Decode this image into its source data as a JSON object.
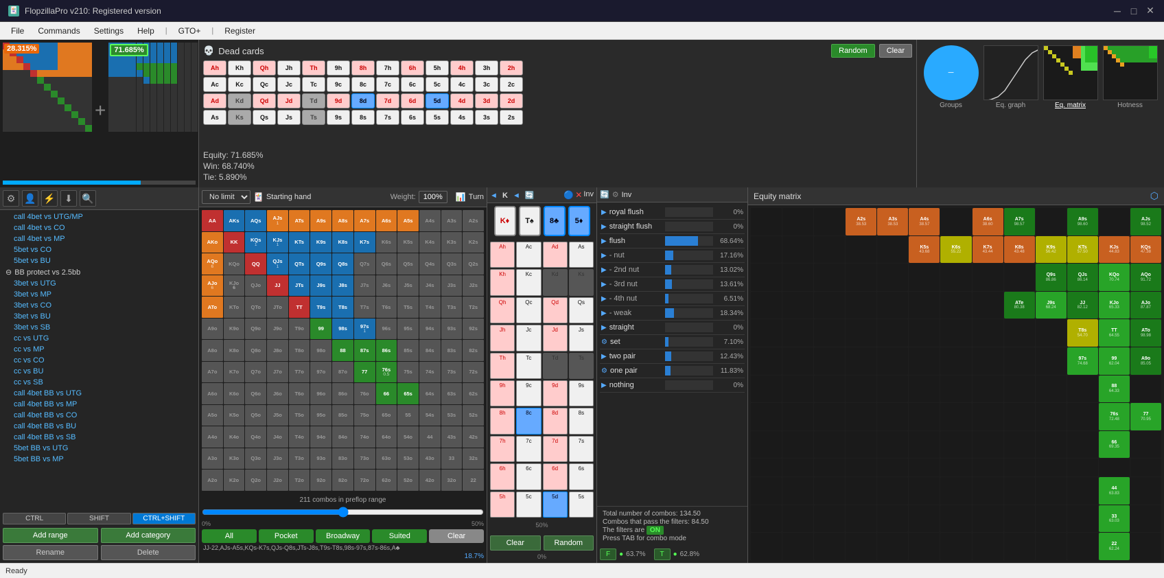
{
  "app": {
    "title": "FlopzillaPro v210: Registered version",
    "icon": "🎴"
  },
  "menu": {
    "items": [
      "File",
      "Commands",
      "Settings",
      "Help",
      "|",
      "GTO+",
      "|",
      "Register"
    ]
  },
  "top_left": {
    "pct1": "28.315%",
    "pct2": "71.685%",
    "pct1_color": "#e8680a",
    "pct2_color": "#2d8a2d"
  },
  "dead_cards": {
    "title": "Dead cards",
    "skull": "💀",
    "rows": [
      [
        "Ah",
        "Kh",
        "Qh",
        "Jh",
        "Th",
        "9h",
        "8h",
        "7h",
        "6h",
        "5h",
        "4h",
        "3h",
        "2h"
      ],
      [
        "Ac",
        "Kc",
        "Qc",
        "Jc",
        "Tc",
        "9c",
        "8c",
        "7c",
        "6c",
        "5c",
        "4c",
        "3c",
        "2c"
      ],
      [
        "Ad",
        "Kd",
        "Qd",
        "Jd",
        "Td",
        "9d",
        "8d",
        "7d",
        "6d",
        "5d",
        "4d",
        "3d",
        "2d"
      ],
      [
        "As",
        "Ks",
        "Qs",
        "Js",
        "Ts",
        "9s",
        "8s",
        "7s",
        "6s",
        "5s",
        "4s",
        "3s",
        "2s"
      ]
    ],
    "btn_random": "Random",
    "btn_clear": "Clear",
    "equity": "Equity: 71.685%",
    "win": "Win: 68.740%",
    "tie": "Tie: 5.890%"
  },
  "viz": {
    "groups_label": "Groups",
    "eq_graph_label": "Eq. graph",
    "eq_matrix_label": "Eq. matrix",
    "hotness_label": "Hotness"
  },
  "range_list": {
    "items": [
      {
        "type": "item",
        "label": "call 4bet vs UTG/MP"
      },
      {
        "type": "item",
        "label": "call 4bet vs CO"
      },
      {
        "type": "item",
        "label": "call 4bet vs MP"
      },
      {
        "type": "item",
        "label": "5bet vs CO"
      },
      {
        "type": "item",
        "label": "5bet vs BU"
      },
      {
        "type": "category",
        "label": "BB protect vs 2.5bb"
      },
      {
        "type": "item",
        "label": "3bet vs UTG"
      },
      {
        "type": "item",
        "label": "3bet vs MP"
      },
      {
        "type": "item",
        "label": "3bet vs CO"
      },
      {
        "type": "item",
        "label": "3bet vs BU"
      },
      {
        "type": "item",
        "label": "3bet vs SB"
      },
      {
        "type": "item",
        "label": "cc vs UTG"
      },
      {
        "type": "item",
        "label": "cc vs MP"
      },
      {
        "type": "item",
        "label": "cc vs CO"
      },
      {
        "type": "item",
        "label": "cc vs BU"
      },
      {
        "type": "item",
        "label": "cc vs SB"
      },
      {
        "type": "item",
        "label": "call 4bet BB vs UTG"
      },
      {
        "type": "item",
        "label": "call 4bet BB vs MP"
      },
      {
        "type": "item",
        "label": "call 4bet BB vs CO"
      },
      {
        "type": "item",
        "label": "call 4bet BB vs BU"
      },
      {
        "type": "item",
        "label": "call 4bet BB vs SB"
      },
      {
        "type": "item",
        "label": "5bet BB vs UTG"
      },
      {
        "type": "item",
        "label": "5bet BB vs MP"
      }
    ],
    "ctrl_labels": [
      "CTRL",
      "SHIFT",
      "CTRL+SHIFT"
    ],
    "btn_add_range": "Add range",
    "btn_add_category": "Add category",
    "btn_rename": "Rename",
    "btn_delete": "Delete"
  },
  "matrix": {
    "title": "Starting hand",
    "weight_label": "Weight:",
    "weight_value": "100%",
    "game_type": "No limit",
    "combos_info": "211 combos in preflop range",
    "pct_value": "18.7%",
    "slider_pct": 50,
    "btn_all": "All",
    "btn_pocket": "Pocket",
    "btn_broadway": "Broadway",
    "btn_suited": "Suited",
    "btn_clear": "Clear",
    "range_str": "JJ-22,AJs-A5s,KQs-K7s,QJs-Q8s,JTs-J8s,T9s-T8s,98s-97s,87s-86s,A♣",
    "hands": [
      [
        "AA",
        "AKs",
        "AQs",
        "AJs",
        "ATs",
        "A9s",
        "A8s",
        "A7s",
        "A6s",
        "A5s",
        "A4s",
        "A3s",
        "A2s"
      ],
      [
        "AKo",
        "KK",
        "KQs",
        "KJs",
        "KTs",
        "K9s",
        "K8s",
        "K7s",
        "K6s",
        "K5s",
        "K4s",
        "K3s",
        "K2s"
      ],
      [
        "AQo",
        "KQo",
        "QQ",
        "QJs",
        "QTs",
        "Q9s",
        "Q8s",
        "Q7s",
        "Q6s",
        "Q5s",
        "Q4s",
        "Q3s",
        "Q2s"
      ],
      [
        "AJo",
        "KJo",
        "QJo",
        "JJ",
        "JTs",
        "J9s",
        "J8s",
        "J7s",
        "J6s",
        "J5s",
        "J4s",
        "J3s",
        "J2s"
      ],
      [
        "ATo",
        "KTo",
        "QTo",
        "JTo",
        "TT",
        "T9s",
        "T8s",
        "T7s",
        "T6s",
        "T5s",
        "T4s",
        "T3s",
        "T2s"
      ],
      [
        "A9o",
        "K9o",
        "Q9o",
        "J9o",
        "T9o",
        "99",
        "98s",
        "97s",
        "96s",
        "95s",
        "94s",
        "93s",
        "92s"
      ],
      [
        "A8o",
        "K8o",
        "Q8o",
        "J8o",
        "T8o",
        "98o",
        "88",
        "87s",
        "86s",
        "85s",
        "84s",
        "83s",
        "82s"
      ],
      [
        "A7o",
        "K7o",
        "Q7o",
        "J7o",
        "T7o",
        "97o",
        "87o",
        "77",
        "76s",
        "75s",
        "74s",
        "73s",
        "72s"
      ],
      [
        "A6o",
        "K6o",
        "Q6o",
        "J6o",
        "T6o",
        "96o",
        "86o",
        "76o",
        "66",
        "65s",
        "64s",
        "63s",
        "62s"
      ],
      [
        "A5o",
        "K5o",
        "Q5o",
        "J5o",
        "T5o",
        "95o",
        "85o",
        "75o",
        "65o",
        "55",
        "54s",
        "53s",
        "52s"
      ],
      [
        "A4o",
        "K4o",
        "Q4o",
        "J4o",
        "T4o",
        "94o",
        "84o",
        "74o",
        "64o",
        "54o",
        "44",
        "43s",
        "42s"
      ],
      [
        "A3o",
        "K3o",
        "Q3o",
        "J3o",
        "T3o",
        "93o",
        "83o",
        "73o",
        "63o",
        "53o",
        "43o",
        "33",
        "32s"
      ],
      [
        "A2o",
        "K2o",
        "Q2o",
        "J2o",
        "T2o",
        "92o",
        "82o",
        "72o",
        "62o",
        "52o",
        "42o",
        "32o",
        "22"
      ]
    ],
    "hand_colors": {
      "AA": "red",
      "AKs": "blue",
      "AQs": "blue",
      "AJs": "orange",
      "ATs": "orange",
      "A9s": "orange",
      "A8s": "orange",
      "A7s": "orange",
      "A6s": "orange",
      "A5s": "orange",
      "KK": "red",
      "KQs": "blue",
      "KJs": "blue",
      "KTs": "blue",
      "K9s": "blue",
      "K8s": "blue",
      "K7s": "blue",
      "QQ": "red",
      "QJs": "blue",
      "QTs": "blue",
      "Q9s": "blue",
      "Q8s": "blue",
      "JJ": "red",
      "JTs": "blue",
      "J9s": "blue",
      "J8s": "blue",
      "TT": "red",
      "T9s": "blue",
      "T8s": "blue",
      "99": "green",
      "98s": "blue",
      "97s": "blue",
      "88": "green",
      "87s": "blue",
      "86s": "blue",
      "77": "green",
      "76s": "green",
      "66": "green",
      "65s": "green",
      "55": "light",
      "54s": "light",
      "44": "light",
      "43s": "light",
      "33": "light",
      "22": "light",
      "AKo": "yellow",
      "AQo": "yellow",
      "AJo": "yellow",
      "ATo": "yellow"
    }
  },
  "board": {
    "title": "Turn",
    "nav_labels": [
      "◄",
      "K",
      "◄",
      "T",
      "8♣",
      "5♦"
    ],
    "selected_cards": [
      "K♦",
      "T♠",
      "8♣",
      "5♦"
    ],
    "board_cards": [
      [
        "Ah",
        "Kh",
        "Qh",
        "Jh"
      ],
      [
        "Ac",
        "Kc",
        "Qc",
        "Jc"
      ],
      [
        "Ad",
        "Kd",
        "Qd",
        "Jd"
      ],
      [
        "As",
        "Ks",
        "Qs",
        "Js"
      ]
    ],
    "pct_50": "50%",
    "pct_0": "0%",
    "btn_clear": "Clear",
    "btn_random": "Random"
  },
  "categories": {
    "toolbar_icons": [
      "🔵",
      "❌"
    ],
    "inv_label": "Inv",
    "items": [
      {
        "name": "royal flush",
        "pct": 0,
        "bar": 0,
        "color": "#2a7fd4"
      },
      {
        "name": "straight flush",
        "pct": 0,
        "bar": 0,
        "color": "#2a7fd4"
      },
      {
        "name": "flush",
        "pct": 68.64,
        "bar": 68.64,
        "color": "#2a7fd4"
      },
      {
        "name": "- nut",
        "pct": 17.16,
        "bar": 17.16,
        "color": "#2a7fd4"
      },
      {
        "name": "- 2nd nut",
        "pct": 13.02,
        "bar": 13.02,
        "color": "#2a7fd4"
      },
      {
        "name": "- 3rd nut",
        "pct": 13.61,
        "bar": 13.61,
        "color": "#2a7fd4"
      },
      {
        "name": "- 4th nut",
        "pct": 6.51,
        "bar": 6.51,
        "color": "#2a7fd4"
      },
      {
        "name": "- weak",
        "pct": 18.34,
        "bar": 18.34,
        "color": "#2a7fd4"
      },
      {
        "name": "straight",
        "pct": 0,
        "bar": 0,
        "color": "#2a7fd4"
      },
      {
        "name": "set",
        "pct": 7.1,
        "bar": 7.1,
        "color": "#2a7fd4"
      },
      {
        "name": "two pair",
        "pct": 12.43,
        "bar": 12.43,
        "color": "#2a7fd4"
      },
      {
        "name": "one pair",
        "pct": 11.83,
        "bar": 11.83,
        "color": "#2a7fd4"
      },
      {
        "name": "nothing",
        "pct": 0,
        "bar": 0,
        "color": "#2a7fd4"
      }
    ],
    "combos_total": "Total number of combos: 134.50",
    "combos_pass": "Combos that pass the filters: 84.50",
    "filters_on": "The filters are ON",
    "press_tab": "Press TAB for combo mode",
    "filter_f_pct": "63.7%",
    "filter_t_pct": "62.8%"
  },
  "equity_matrix": {
    "title": "Equity matrix",
    "cells": [
      {
        "label": "AJs",
        "val": "98.52",
        "color": "green3"
      },
      {
        "label": "A9s",
        "val": "98.60",
        "color": "green3"
      },
      {
        "label": "A7s",
        "val": "98.57",
        "color": "green3"
      },
      {
        "label": "A6s",
        "val": "38.60",
        "color": "orange"
      },
      {
        "label": "A4s",
        "val": "38.57",
        "color": "orange"
      },
      {
        "label": "A3s",
        "val": "38.53",
        "color": "orange"
      },
      {
        "label": "A2s",
        "val": "38.53",
        "color": "orange"
      },
      {
        "label": "KQs",
        "val": "47.38",
        "color": "orange"
      },
      {
        "label": "KJs",
        "val": "44.83",
        "color": "orange"
      },
      {
        "label": "KTs",
        "val": "57.50",
        "color": "yellow"
      },
      {
        "label": "K9s",
        "val": "56.42",
        "color": "yellow"
      },
      {
        "label": "K8s",
        "val": "43.48",
        "color": "orange"
      },
      {
        "label": "K7s",
        "val": "43.44",
        "color": "orange"
      },
      {
        "label": "K6s",
        "val": "55.22",
        "color": "yellow"
      },
      {
        "label": "K5s",
        "val": "43.68",
        "color": "orange"
      },
      {
        "label": "K4s",
        "val": "",
        "color": "empty"
      },
      {
        "label": "AQo",
        "val": "91.72",
        "color": "green3"
      },
      {
        "label": "KQo",
        "val": "70.74",
        "color": "green2"
      },
      {
        "label": "QJs",
        "val": "86.14",
        "color": "green3"
      },
      {
        "label": "Q9s",
        "val": "86.86",
        "color": "green3"
      },
      {
        "label": "AJo",
        "val": "87.87",
        "color": "green3"
      },
      {
        "label": "KJo",
        "val": "65.33",
        "color": "green2"
      },
      {
        "label": "JJ",
        "val": "82.12",
        "color": "green3"
      },
      {
        "label": "J9s",
        "val": "68.24",
        "color": "green2"
      },
      {
        "label": "ATe",
        "val": "80.38",
        "color": "green3"
      },
      {
        "label": "ATo",
        "val": "98.98",
        "color": "green3"
      },
      {
        "label": "TT",
        "val": "64.55",
        "color": "green2"
      },
      {
        "label": "T8s",
        "val": "54.70",
        "color": "yellow"
      },
      {
        "label": "A9o",
        "val": "85.05",
        "color": "green3"
      },
      {
        "label": "99",
        "val": "62.04",
        "color": "green2"
      },
      {
        "label": "97s",
        "val": "74.68",
        "color": "green2"
      },
      {
        "label": "88",
        "val": "64.33",
        "color": "green2"
      },
      {
        "label": "77",
        "val": "70.95",
        "color": "green2"
      },
      {
        "label": "76s",
        "val": "72.48",
        "color": "green2"
      },
      {
        "label": "66",
        "val": "69.35",
        "color": "green2"
      },
      {
        "label": "44",
        "val": "63.83",
        "color": "green2"
      },
      {
        "label": "33",
        "val": "63.03",
        "color": "green2"
      },
      {
        "label": "22",
        "val": "62.24",
        "color": "green2"
      }
    ]
  },
  "status": {
    "text": "Ready"
  }
}
